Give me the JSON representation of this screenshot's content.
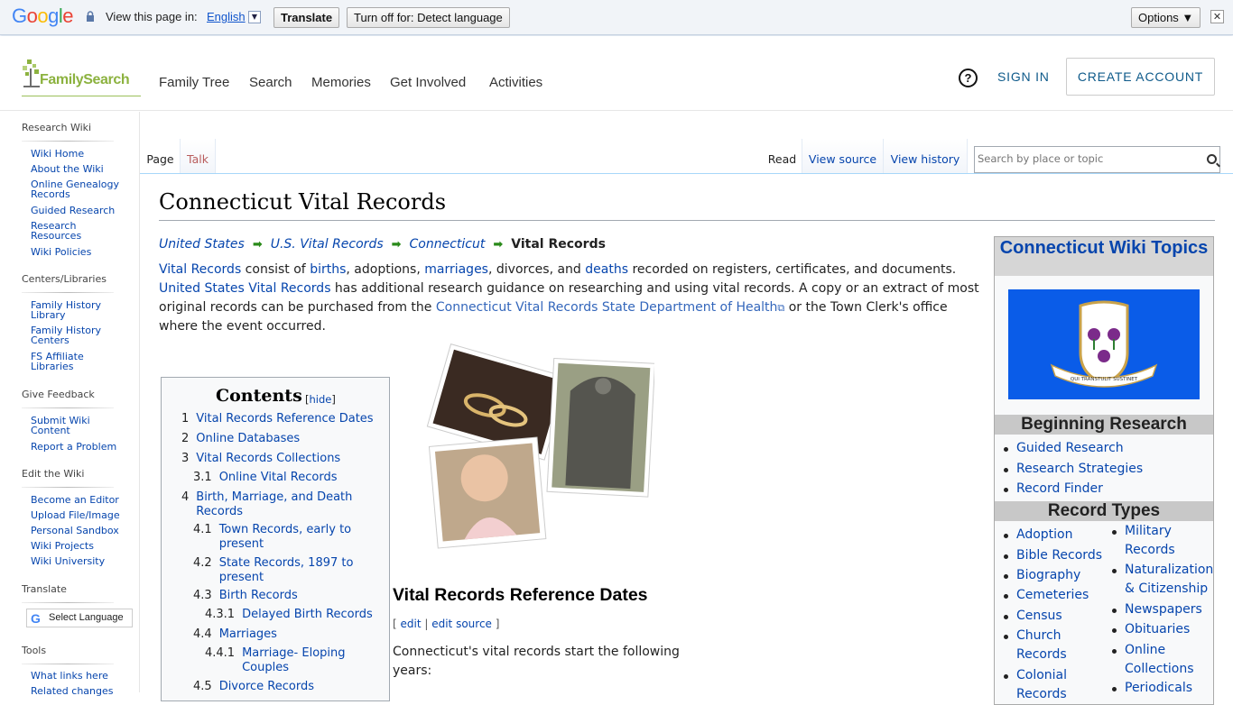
{
  "translate_bar": {
    "logo": "Google",
    "view_text": "View this page in:",
    "language": "English",
    "translate_btn": "Translate",
    "turn_off_btn": "Turn off for: Detect language",
    "options_btn": "Options ▼"
  },
  "header": {
    "logo": "FamilySearch",
    "nav": [
      "Family Tree",
      "Search",
      "Memories",
      "Get Involved",
      "Activities"
    ],
    "sign_in": "SIGN IN",
    "create_account": "CREATE ACCOUNT"
  },
  "sidebar": {
    "research_wiki": "Research Wiki",
    "wiki_items": [
      "Wiki Home",
      "About the Wiki",
      "Online Genealogy Records",
      "Guided Research",
      "Research Resources",
      "Wiki Policies"
    ],
    "centers": "Centers/Libraries",
    "center_items": [
      "Family History Library",
      "Family History Centers",
      "FS Affiliate Libraries"
    ],
    "feedback": "Give Feedback",
    "feedback_items": [
      "Submit Wiki Content",
      "Report a Problem"
    ],
    "edit": "Edit the Wiki",
    "edit_items": [
      "Become an Editor",
      "Upload File/Image",
      "Personal Sandbox",
      "Wiki Projects",
      "Wiki University"
    ],
    "translate": "Translate",
    "select_language": "Select Language",
    "tools": "Tools",
    "tool_items": [
      "What links here",
      "Related changes"
    ]
  },
  "tabs": {
    "page": "Page",
    "talk": "Talk",
    "read": "Read",
    "view_source": "View source",
    "view_history": "View history",
    "search_placeholder": "Search by place or topic"
  },
  "article": {
    "title": "Connecticut Vital Records",
    "breadcrumb": [
      "United States",
      "U.S. Vital Records",
      "Connecticut"
    ],
    "breadcrumb_current": "Vital Records",
    "intro": {
      "l_vital": "Vital Records",
      "t1": " consist of ",
      "l_births": "births",
      "t2": ", adoptions, ",
      "l_marriages": "marriages",
      "t3": ", divorces, and ",
      "l_deaths": "deaths",
      "t4": " recorded on registers, certificates, and documents. ",
      "l_us": "United States Vital Records",
      "t5": " has additional research guidance on researching and using vital records. A copy or an extract of most original records can be purchased from the ",
      "l_ct": "Connecticut Vital Records State Department of Health",
      "t6": " or the Town Clerk's office where the event occurred."
    },
    "toc_title": "Contents",
    "toc_hide": "hide",
    "toc": [
      {
        "num": "1",
        "text": "Vital Records Reference Dates"
      },
      {
        "num": "2",
        "text": "Online Databases"
      },
      {
        "num": "3",
        "text": "Vital Records Collections"
      },
      {
        "num": "3.1",
        "text": "Online Vital Records"
      },
      {
        "num": "4",
        "text": "Birth, Marriage, and Death Records"
      },
      {
        "num": "4.1",
        "text": "Town Records, early to present"
      },
      {
        "num": "4.2",
        "text": "State Records, 1897 to present"
      },
      {
        "num": "4.3",
        "text": "Birth Records"
      },
      {
        "num": "4.3.1",
        "text": "Delayed Birth Records"
      },
      {
        "num": "4.4",
        "text": "Marriages"
      },
      {
        "num": "4.4.1",
        "text": "Marriage- Eloping Couples"
      },
      {
        "num": "4.5",
        "text": "Divorce Records"
      }
    ],
    "section_title": "Vital Records Reference Dates",
    "edit": "edit",
    "edit_source": "edit source",
    "para": "Connecticut's vital records start the following years:"
  },
  "infobox": {
    "title": "Connecticut Wiki Topics",
    "flag_motto": "QUI TRANSTULIT SUSTINET",
    "beginning": "Beginning Research",
    "beginning_items": [
      "Guided Research",
      "Research Strategies",
      "Record Finder"
    ],
    "record_types": "Record Types",
    "left_items": [
      "Adoption",
      "Bible Records",
      "Biography",
      "Cemeteries",
      "Census",
      "Church Records",
      "Colonial Records"
    ],
    "right_items": [
      "Military Records",
      "Naturalization & Citizenship",
      "Newspapers",
      "Obituaries",
      "Online Collections",
      "Periodicals"
    ]
  }
}
